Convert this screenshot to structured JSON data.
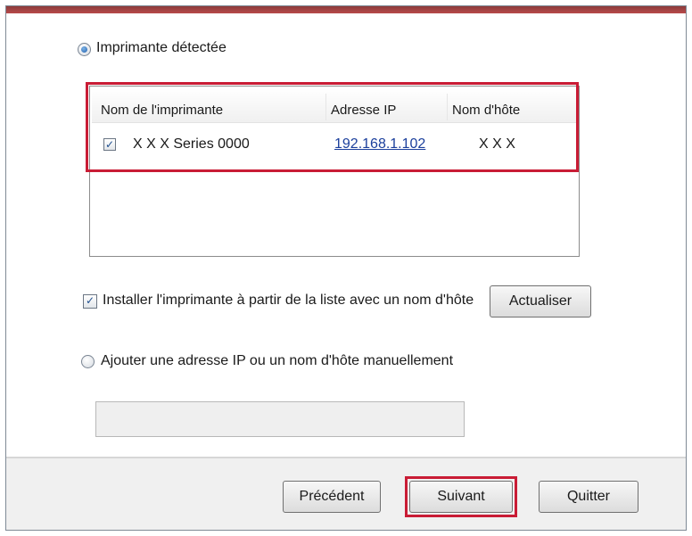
{
  "detected_option": {
    "label": "Imprimante détectée",
    "selected": true
  },
  "printer_list": {
    "columns": [
      "Nom de l'imprimante",
      "Adresse IP",
      "Nom d'hôte"
    ],
    "rows": [
      {
        "checked": true,
        "name": "X X X  Series 0000",
        "ip": "192.168.1.102",
        "host": "X X X"
      }
    ]
  },
  "install_option": {
    "label": "Installer l'imprimante à partir de la liste avec un nom d'hôte",
    "checked": true
  },
  "refresh_button": {
    "label": "Actualiser"
  },
  "manual_option": {
    "label": "Ajouter une adresse IP ou un nom d'hôte manuellement",
    "selected": false
  },
  "manual_input": {
    "value": "",
    "placeholder": ""
  },
  "footer": {
    "back_label": "Précédent",
    "next_label": "Suivant",
    "quit_label": "Quitter"
  },
  "colors": {
    "highlight": "#c91c35",
    "link": "#1b3f9c",
    "title_strip": "#b84a4a"
  }
}
